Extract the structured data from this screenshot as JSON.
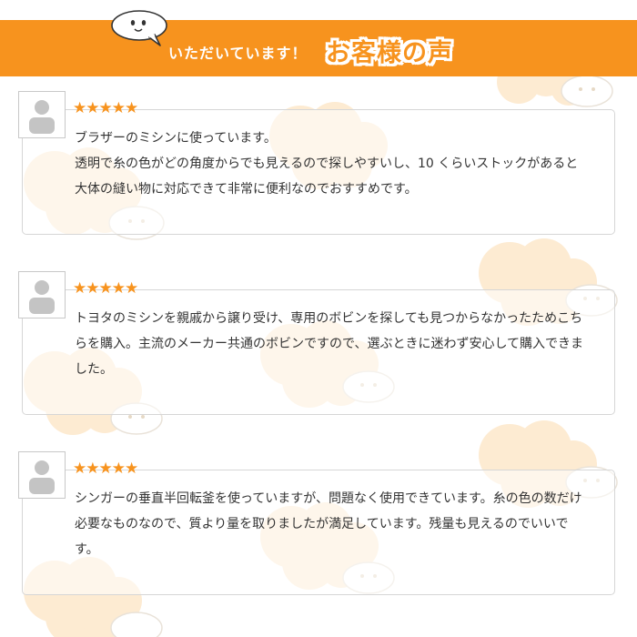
{
  "header": {
    "lead": "いただいています！",
    "title": "お客様の声"
  },
  "reviews": [
    {
      "stars": "★★★★★",
      "text": "ブラザーのミシンに使っています。\n透明で糸の色がどの角度からでも見えるので探しやすいし、10 くらいストックがあると大体の縫い物に対応できて非常に便利なのでおすすめです。"
    },
    {
      "stars": "★★★★★",
      "text": "トヨタのミシンを親戚から譲り受け、専用のボビンを探しても見つからなかったためこちらを購入。主流のメーカー共通のボビンですので、選ぶときに迷わず安心して購入できました。"
    },
    {
      "stars": "★★★★★",
      "text": "シンガーの垂直半回転釜を使っていますが、問題なく使用できています。糸の色の数だけ必要なものなので、質より量を取りましたが満足しています。残量も見えるのでいいです。"
    }
  ]
}
